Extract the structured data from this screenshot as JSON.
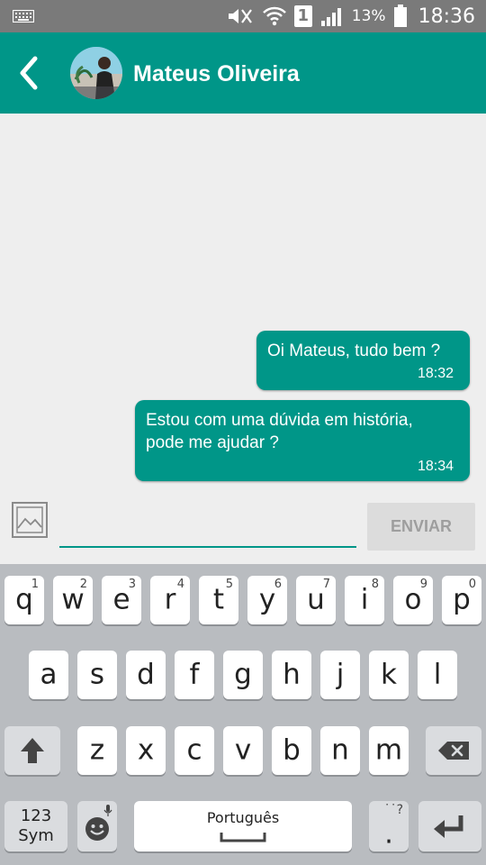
{
  "status_bar": {
    "battery_percent": "13%",
    "time": "18:36",
    "sim_slot": "1",
    "icons": [
      "keyboard-indicator-icon",
      "mute-icon",
      "wifi-icon",
      "sim-icon",
      "signal-icon",
      "battery-icon"
    ]
  },
  "header": {
    "contact_name": "Mateus Oliveira",
    "back_icon": "chevron-left-icon",
    "avatar": "contact-avatar"
  },
  "messages": [
    {
      "text": "Oi Mateus, tudo bem ?",
      "time": "18:32"
    },
    {
      "text": "Estou com uma dúvida em história,\npode me ajudar ?",
      "time": "18:34"
    }
  ],
  "composer": {
    "image_icon": "image-icon",
    "input_value": "",
    "send_label": "ENVIAR"
  },
  "keyboard": {
    "row1": [
      {
        "k": "q",
        "h": "1"
      },
      {
        "k": "w",
        "h": "2"
      },
      {
        "k": "e",
        "h": "3"
      },
      {
        "k": "r",
        "h": "4"
      },
      {
        "k": "t",
        "h": "5"
      },
      {
        "k": "y",
        "h": "6"
      },
      {
        "k": "u",
        "h": "7"
      },
      {
        "k": "i",
        "h": "8"
      },
      {
        "k": "o",
        "h": "9"
      },
      {
        "k": "p",
        "h": "0"
      }
    ],
    "row2": [
      "a",
      "s",
      "d",
      "f",
      "g",
      "h",
      "j",
      "k",
      "l"
    ],
    "row3": [
      "z",
      "x",
      "c",
      "v",
      "b",
      "n",
      "m"
    ],
    "sym_line1": "123",
    "sym_line2": "Sym",
    "space_label": "Português",
    "period_label": ".",
    "period_hint": "˙˙?",
    "colors": {
      "accent": "#009688",
      "keyboard_bg": "#b9bcc0"
    }
  }
}
